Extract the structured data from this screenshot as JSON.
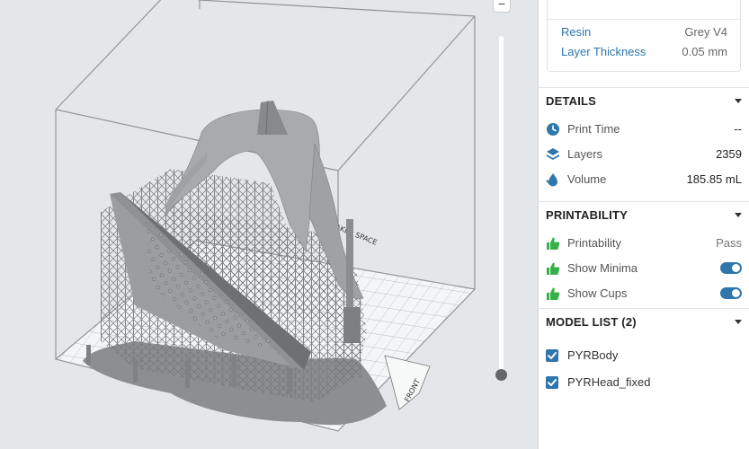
{
  "viewport": {
    "zoom_minus_label": "−",
    "floor_label_front": "FRONT",
    "floor_label_side": "MAKER SPACE"
  },
  "material": {
    "resin_label": "Resin",
    "resin_value": "Grey V4",
    "layer_thickness_label": "Layer Thickness",
    "layer_thickness_value": "0.05 mm"
  },
  "details": {
    "title": "DETAILS",
    "print_time_label": "Print Time",
    "print_time_value": "--",
    "layers_label": "Layers",
    "layers_value": "2359",
    "volume_label": "Volume",
    "volume_value": "185.85 mL"
  },
  "printability": {
    "title": "PRINTABILITY",
    "printability_label": "Printability",
    "printability_value": "Pass",
    "show_minima_label": "Show Minima",
    "show_minima_on": true,
    "show_cups_label": "Show Cups",
    "show_cups_on": true
  },
  "model_list": {
    "title": "MODEL LIST (2)",
    "items": [
      {
        "name": "PYRBody",
        "checked": true
      },
      {
        "name": "PYRHead_fixed",
        "checked": true
      }
    ]
  },
  "colors": {
    "accent": "#2f76ad",
    "thumb_green": "#37b04a",
    "panel_bg": "#ffffff",
    "viewport_bg": "#e4e7ea"
  },
  "icons": {
    "clock": "clock-icon",
    "layers": "layers-icon",
    "volume": "volume-icon",
    "thumbs_up": "thumbs-up-icon",
    "caret": "chevron-down-icon",
    "check": "checkbox-check-icon"
  }
}
